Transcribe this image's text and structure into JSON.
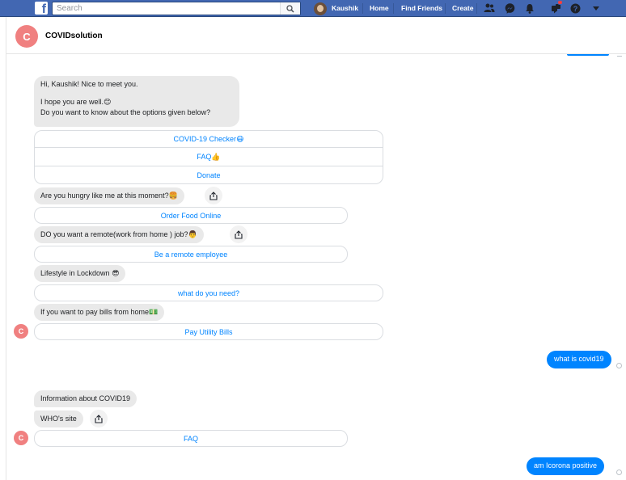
{
  "topbar": {
    "logo": "f",
    "search_placeholder": "Search",
    "profile_name": "Kaushik",
    "links": {
      "home": "Home",
      "find_friends": "Find Friends",
      "create": "Create"
    }
  },
  "header": {
    "avatar_letter": "C",
    "name": "COVIDsolution"
  },
  "messages": {
    "greeting_line1": "Hi, Kaushik! Nice to meet you.",
    "greeting_line2": "I hope you are well.",
    "greeting_line3": "Do you want to know about the options given below?",
    "opt_checker": "COVID-19 Checker",
    "opt_faq": "FAQ",
    "opt_donate": "Donate",
    "hungry": "Are you hungry like me at this moment?",
    "order_food": "Order Food Online",
    "remote_q": "DO you want  a remote(work from home ) job?",
    "remote_btn": "Be a remote employee",
    "lifestyle": "Lifestyle in Lockdown",
    "what_need": "what do you need?",
    "bills_q": "If you want to pay bills from home",
    "bills_btn": "Pay Utility Bills",
    "user_msg1": "what is covid19",
    "info_covid": "Information about COVID19",
    "who_site": "WHO's site",
    "faq_btn": "FAQ",
    "user_msg2": "am Icorona positive",
    "bot_avatar_letter": "C"
  },
  "emoji": {
    "smile": "😊",
    "mask": "😷",
    "thumbs": "👍",
    "burger": "🍔",
    "worker": "👨",
    "sunglasses": "😎",
    "money": "💵"
  },
  "colors": {
    "brand": "#4267b2",
    "accent": "#0084ff",
    "avatar": "#f08080"
  }
}
